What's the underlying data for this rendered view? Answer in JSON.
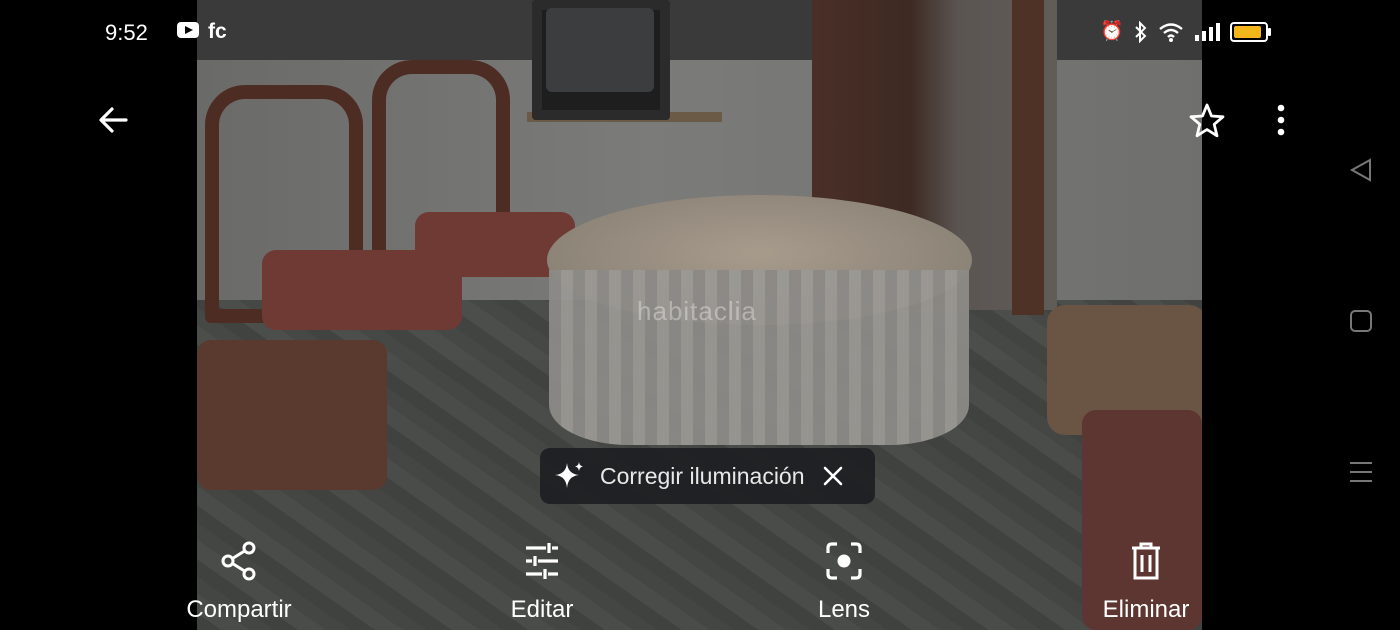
{
  "status_bar": {
    "time": "9:52",
    "notification_app": "fc",
    "icons": [
      "youtube-icon",
      "alarm-icon",
      "bluetooth-icon",
      "wifi-icon",
      "signal-icon",
      "battery-icon"
    ],
    "battery_color": "#f2b51a"
  },
  "toolbar": {
    "back_icon": "arrow-left-icon",
    "favorite_icon": "star-outline-icon",
    "more_icon": "more-vertical-icon"
  },
  "photo": {
    "watermark": "habitaclia"
  },
  "suggestion_chip": {
    "icon": "sparkle-icon",
    "label": "Corregir iluminación",
    "close_icon": "close-icon"
  },
  "actions": [
    {
      "label": "Compartir",
      "icon": "share-icon"
    },
    {
      "label": "Editar",
      "icon": "tune-icon"
    },
    {
      "label": "Lens",
      "icon": "lens-icon"
    },
    {
      "label": "Eliminar",
      "icon": "trash-icon"
    }
  ],
  "system_nav": [
    "back-triangle-icon",
    "home-square-icon",
    "recents-menu-icon"
  ]
}
